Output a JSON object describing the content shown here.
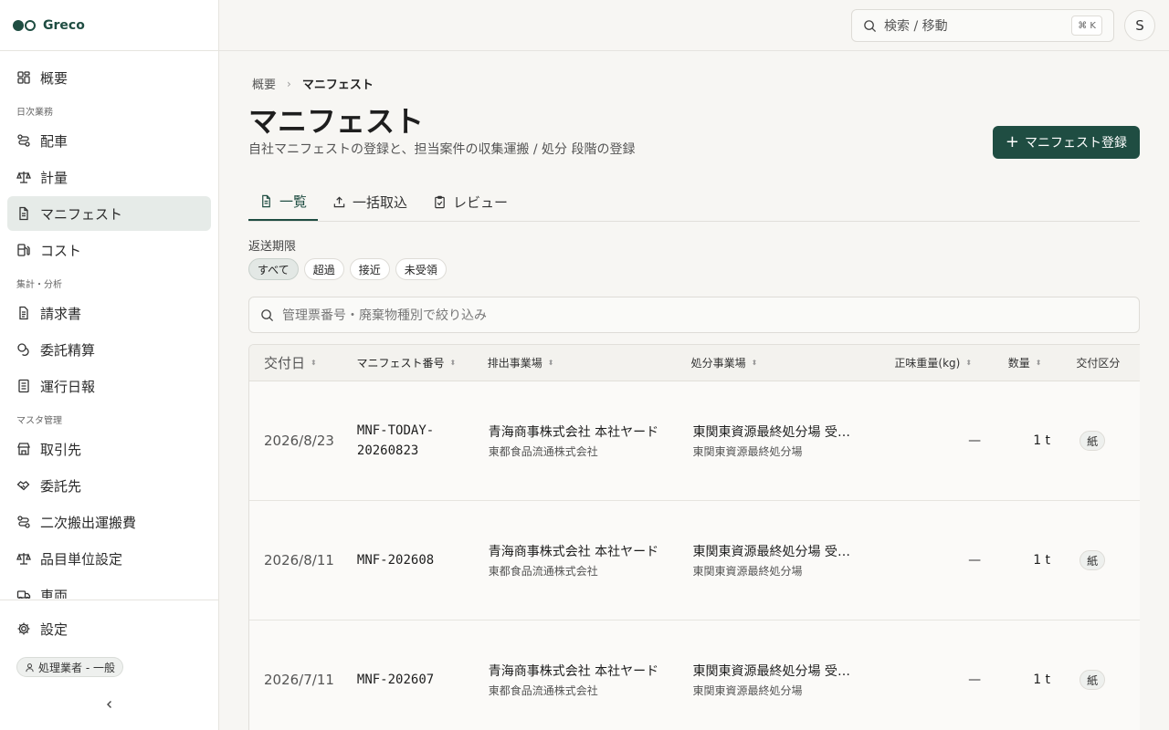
{
  "brand": {
    "name": "Greco"
  },
  "sidebar": {
    "top_item": {
      "label": "概要",
      "icon": "dashboard-icon"
    },
    "sections": [
      {
        "title": "日次業務",
        "items": [
          {
            "label": "配車",
            "icon": "route-icon"
          },
          {
            "label": "計量",
            "icon": "scale-icon"
          },
          {
            "label": "マニフェスト",
            "icon": "document-icon",
            "active": true
          },
          {
            "label": "コスト",
            "icon": "fuel-icon"
          }
        ]
      },
      {
        "title": "集計・分析",
        "items": [
          {
            "label": "請求書",
            "icon": "invoice-icon"
          },
          {
            "label": "委託精算",
            "icon": "coins-icon"
          },
          {
            "label": "運行日報",
            "icon": "report-icon"
          }
        ]
      },
      {
        "title": "マスタ管理",
        "items": [
          {
            "label": "取引先",
            "icon": "store-icon"
          },
          {
            "label": "委託先",
            "icon": "handshake-icon"
          },
          {
            "label": "二次搬出運搬費",
            "icon": "route-icon"
          },
          {
            "label": "品目単位設定",
            "icon": "scale-icon"
          },
          {
            "label": "車両",
            "icon": "truck-icon"
          }
        ]
      }
    ],
    "settings_label": "設定",
    "role_badge": "処理業者 - 一般"
  },
  "topbar": {
    "search_placeholder": "検索 / 移動",
    "shortcut": "⌘ K",
    "avatar_initial": "S"
  },
  "page": {
    "breadcrumb_root": "概要",
    "breadcrumb_current": "マニフェスト",
    "title": "マニフェスト",
    "subtitle": "自社マニフェストの登録と、担当案件の収集運搬 / 処分 段階の登録",
    "primary_button": "マニフェスト登録",
    "tabs": [
      {
        "label": "一覧",
        "icon": "list-document-icon",
        "active": true
      },
      {
        "label": "一括取込",
        "icon": "upload-icon"
      },
      {
        "label": "レビュー",
        "icon": "clipboard-check-icon"
      }
    ],
    "filter_label": "返送期限",
    "chips": [
      {
        "label": "すべて",
        "active": true
      },
      {
        "label": "超過"
      },
      {
        "label": "接近"
      },
      {
        "label": "未受領"
      }
    ],
    "filter_placeholder": "管理票番号・廃棄物種別で絞り込み"
  },
  "table": {
    "columns": [
      "交付日",
      "マニフェスト番号",
      "排出事業場",
      "処分事業場",
      "正味重量(kg)",
      "数量",
      "交付区分"
    ],
    "rows": [
      {
        "date": "2026/8/23",
        "number": "MNF-TODAY-20260823",
        "emitter": "青海商事株式会社 本社ヤード",
        "emitter_sub": "東都食品流通株式会社",
        "disposer": "東関東資源最終処分場 受入口",
        "disposer_sub": "東関東資源最終処分場",
        "weight": "—",
        "qty": "1 t",
        "kind": "紙"
      },
      {
        "date": "2026/8/11",
        "number": "MNF-202608",
        "emitter": "青海商事株式会社 本社ヤード",
        "emitter_sub": "東都食品流通株式会社",
        "disposer": "東関東資源最終処分場 受入口",
        "disposer_sub": "東関東資源最終処分場",
        "weight": "—",
        "qty": "1 t",
        "kind": "紙"
      },
      {
        "date": "2026/7/11",
        "number": "MNF-202607",
        "emitter": "青海商事株式会社 本社ヤード",
        "emitter_sub": "東都食品流通株式会社",
        "disposer": "東関東資源最終処分場 受入口",
        "disposer_sub": "東関東資源最終処分場",
        "weight": "—",
        "qty": "1 t",
        "kind": "紙"
      }
    ]
  },
  "colors": {
    "accent": "#1f4d42",
    "background": "#f7f6f3",
    "active_nav": "#e6ebe8"
  }
}
